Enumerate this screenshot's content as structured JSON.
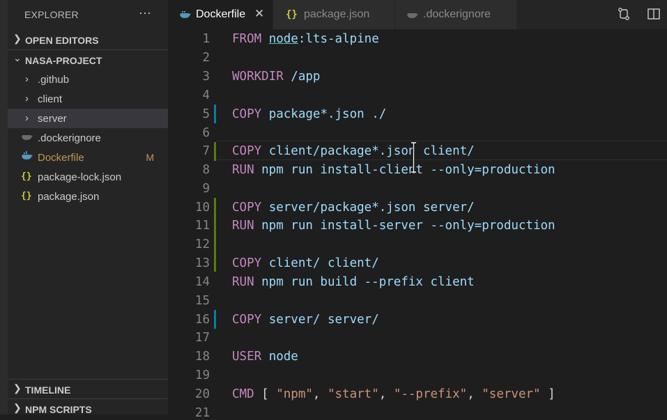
{
  "explorer": {
    "title": "EXPLORER",
    "more": "···",
    "sections": {
      "open_editors": "OPEN EDITORS",
      "project": "NASA-PROJECT",
      "timeline": "TIMELINE",
      "npm_scripts": "NPM SCRIPTS"
    },
    "folders": [
      ".github",
      "client",
      "server"
    ],
    "files": [
      {
        "name": ".dockerignore",
        "icon": "docker-icon",
        "modified": ""
      },
      {
        "name": "Dockerfile",
        "icon": "docker-icon",
        "modified": "M"
      },
      {
        "name": "package-lock.json",
        "icon": "json-icon",
        "modified": ""
      },
      {
        "name": "package.json",
        "icon": "json-icon",
        "modified": ""
      }
    ]
  },
  "tabs": [
    {
      "label": "Dockerfile",
      "icon": "docker-icon",
      "active": true,
      "close": "✕"
    },
    {
      "label": "package.json",
      "icon": "json-icon",
      "active": false
    },
    {
      "label": ".dockerignore",
      "icon": "docker-icon",
      "active": false
    }
  ],
  "toolbar": {
    "compare_icon": "compare-changes-icon",
    "split_icon": "split-editor-icon"
  },
  "editor": {
    "line_numbers": [
      "1",
      "2",
      "3",
      "4",
      "5",
      "6",
      "7",
      "8",
      "9",
      "10",
      "11",
      "12",
      "13",
      "14",
      "15",
      "16",
      "17",
      "18",
      "19",
      "20",
      "21"
    ],
    "lines": {
      "l1": {
        "kw": "FROM",
        "img": "node",
        "rest": ":lts-alpine"
      },
      "l3": {
        "kw": "WORKDIR",
        "rest": " /app"
      },
      "l5": {
        "kw": "COPY",
        "rest": " package*.json ./"
      },
      "l7": {
        "kw": "COPY",
        "rest": " client/package*.json client/"
      },
      "l8": {
        "kw": "RUN",
        "rest": " npm run install-client --only=production"
      },
      "l10": {
        "kw": "COPY",
        "rest": " server/package*.json server/"
      },
      "l11": {
        "kw": "RUN",
        "rest": " npm run install-server --only=production"
      },
      "l13": {
        "kw": "COPY",
        "rest": " client/ client/"
      },
      "l14": {
        "kw": "RUN",
        "rest": " npm run build --prefix client"
      },
      "l16": {
        "kw": "COPY",
        "rest": " server/ server/"
      },
      "l18": {
        "kw": "USER",
        "rest": " node"
      },
      "l20": {
        "kw": "CMD",
        "open": " [ ",
        "a1": "\"npm\"",
        "c1": ", ",
        "a2": "\"start\"",
        "c2": ", ",
        "a3": "\"--prefix\"",
        "c3": ", ",
        "a4": "\"server\"",
        "close": " ]"
      }
    }
  },
  "colors": {
    "accent_blue": "#519aba",
    "json_yellow": "#cbcb41",
    "modified": "#c09553",
    "git_added": "#587c0c",
    "git_modified": "#0c7d9d"
  }
}
